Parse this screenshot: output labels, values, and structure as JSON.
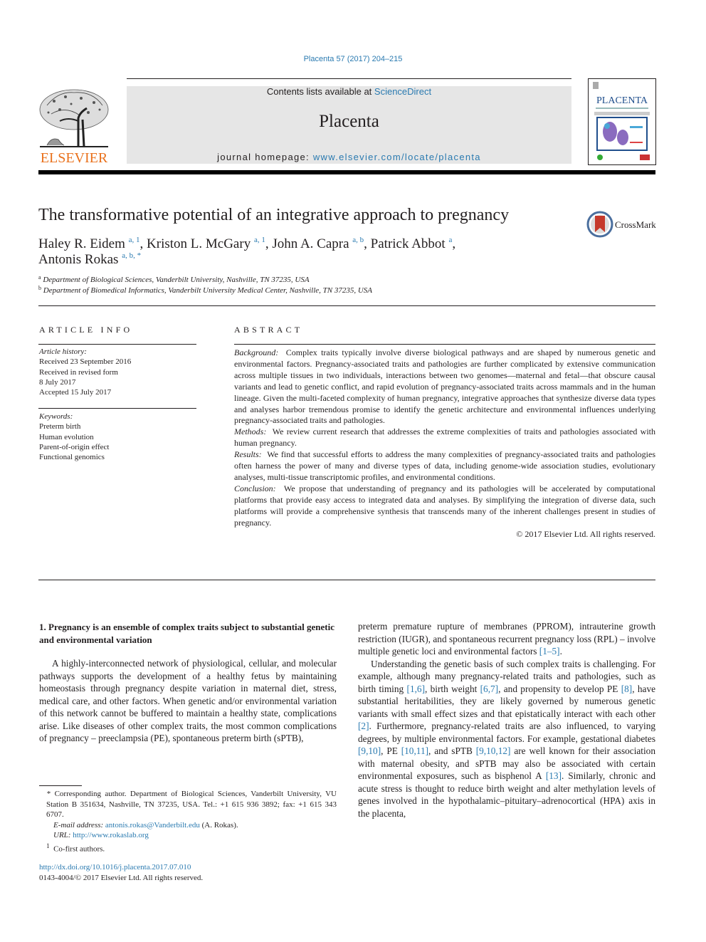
{
  "header": {
    "citation": "Placenta 57 (2017) 204–215",
    "publisher_logo_text": "ELSEVIER",
    "contents_prefix": "Contents lists available at ",
    "contents_link": "ScienceDirect",
    "journal_name": "Placenta",
    "homepage_prefix": "journal homepage: ",
    "homepage_link": "www.elsevier.com/locate/placenta",
    "cover_title": "PLACENTA",
    "colors": {
      "link": "#2a7ab0",
      "elsevier_orange": "#e9711c",
      "masthead_bg": "#e6e6e6"
    }
  },
  "article": {
    "title": "The transformative potential of an integrative approach to pregnancy",
    "crossmark_label": "CrossMark",
    "authors": [
      {
        "name": "Haley R. Eidem",
        "sup": "a, 1",
        "sep": ", "
      },
      {
        "name": "Kriston L. McGary",
        "sup": "a, 1",
        "sep": ", "
      },
      {
        "name": "John A. Capra",
        "sup": "a, b",
        "sep": ", "
      },
      {
        "name": "Patrick Abbot",
        "sup": "a",
        "sep": ","
      },
      {
        "name": "Antonis Rokas",
        "sup": "a, b, *",
        "sep": ""
      }
    ],
    "affiliations": [
      {
        "sup": "a",
        "text": "Department of Biological Sciences, Vanderbilt University, Nashville, TN 37235, USA"
      },
      {
        "sup": "b",
        "text": "Department of Biomedical Informatics, Vanderbilt University Medical Center, Nashville, TN 37235, USA"
      }
    ]
  },
  "article_info": {
    "heading": "ARTICLE INFO",
    "history_label": "Article history:",
    "history": [
      "Received 23 September 2016",
      "Received in revised form",
      "8 July 2017",
      "Accepted 15 July 2017"
    ],
    "keywords_label": "Keywords:",
    "keywords": [
      "Preterm birth",
      "Human evolution",
      "Parent-of-origin effect",
      "Functional genomics"
    ]
  },
  "abstract": {
    "heading": "ABSTRACT",
    "sections": [
      {
        "label": "Background:",
        "text": "Complex traits typically involve diverse biological pathways and are shaped by numerous genetic and environmental factors. Pregnancy-associated traits and pathologies are further complicated by extensive communication across multiple tissues in two individuals, interactions between two genomes—maternal and fetal—that obscure causal variants and lead to genetic conflict, and rapid evolution of pregnancy-associated traits across mammals and in the human lineage. Given the multi-faceted complexity of human pregnancy, integrative approaches that synthesize diverse data types and analyses harbor tremendous promise to identify the genetic architecture and environmental influences underlying pregnancy-associated traits and pathologies."
      },
      {
        "label": "Methods:",
        "text": "We review current research that addresses the extreme complexities of traits and pathologies associated with human pregnancy."
      },
      {
        "label": "Results:",
        "text": "We find that successful efforts to address the many complexities of pregnancy-associated traits and pathologies often harness the power of many and diverse types of data, including genome-wide association studies, evolutionary analyses, multi-tissue transcriptomic profiles, and environmental conditions."
      },
      {
        "label": "Conclusion:",
        "text": "We propose that understanding of pregnancy and its pathologies will be accelerated by computational platforms that provide easy access to integrated data and analyses. By simplifying the integration of diverse data, such platforms will provide a comprehensive synthesis that transcends many of the inherent challenges present in studies of pregnancy."
      }
    ],
    "copyright": "© 2017 Elsevier Ltd. All rights reserved."
  },
  "body": {
    "section_title": "1.  Pregnancy is an ensemble of complex traits subject to substantial genetic and environmental variation",
    "col1_para": "A highly-interconnected network of physiological, cellular, and molecular pathways supports the development of a healthy fetus by maintaining homeostasis through pregnancy despite variation in maternal diet, stress, medical care, and other factors. When genetic and/or environmental variation of this network cannot be buffered to maintain a healthy state, complications arise. Like diseases of other complex traits, the most common complications of pregnancy – preeclampsia (PE), spontaneous preterm birth (sPTB),",
    "col2_p1": {
      "text": "preterm premature rupture of membranes (PPROM), intrauterine growth restriction (IUGR), and spontaneous recurrent pregnancy loss (RPL) – involve multiple genetic loci and environmental factors ",
      "ref": "[1–5]",
      "end": "."
    },
    "col2_p2": [
      {
        "t": "Understanding the genetic basis of such complex traits is challenging. For example, although many pregnancy-related traits and pathologies, such as birth timing "
      },
      {
        "r": "[1,6]"
      },
      {
        "t": ", birth weight "
      },
      {
        "r": "[6,7]"
      },
      {
        "t": ", and propensity to develop PE "
      },
      {
        "r": "[8]"
      },
      {
        "t": ", have substantial heritabilities, they are likely governed by numerous genetic variants with small effect sizes and that epistatically interact with each other "
      },
      {
        "r": "[2]"
      },
      {
        "t": ". Furthermore, pregnancy-related traits are also influenced, to varying degrees, by multiple environmental factors. For example, gestational diabetes "
      },
      {
        "r": "[9,10]"
      },
      {
        "t": ", PE "
      },
      {
        "r": "[10,11]"
      },
      {
        "t": ", and sPTB "
      },
      {
        "r": "[9,10,12]"
      },
      {
        "t": " are well known for their association with maternal obesity, and sPTB may also be associated with certain environmental exposures, such as bisphenol A "
      },
      {
        "r": "[13]"
      },
      {
        "t": ". Similarly, chronic and acute stress is thought to reduce birth weight and alter methylation levels of genes involved in the hypothalamic–pituitary–adrenocortical (HPA) axis in the placenta,"
      }
    ]
  },
  "footnotes": {
    "corresponding": "* Corresponding author. Department of Biological Sciences, Vanderbilt University, VU Station B 351634, Nashville, TN 37235, USA. Tel.: +1 615 936 3892; fax: +1 615 343 6707.",
    "email_label": "E-mail address:",
    "email": "antonis.rokas@Vanderbilt.edu",
    "email_suffix": " (A. Rokas).",
    "url_label": "URL:",
    "url": "http://www.rokaslab.org",
    "cofirst_sup": "1",
    "cofirst": "Co-first authors.",
    "doi": "http://dx.doi.org/10.1016/j.placenta.2017.07.010",
    "issn": "0143-4004/© 2017 Elsevier Ltd. All rights reserved."
  }
}
